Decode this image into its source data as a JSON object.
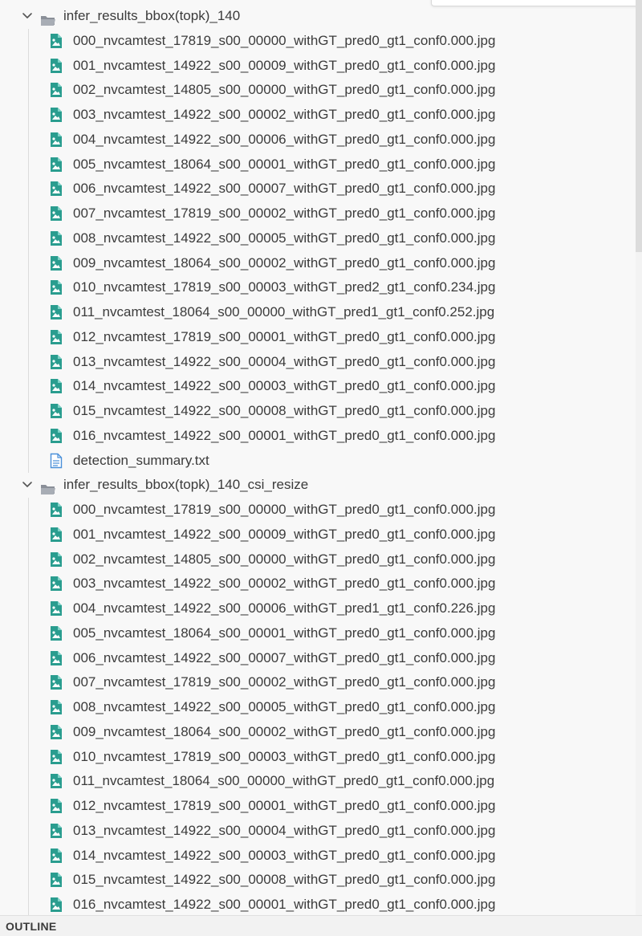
{
  "explorer": {
    "folders": [
      {
        "name": "infer_results_bbox(topk)_140",
        "expanded": true,
        "files": [
          {
            "name": "000_nvcamtest_17819_s00_00000_withGT_pred0_gt1_conf0.000.jpg",
            "icon": "image-file-icon"
          },
          {
            "name": "001_nvcamtest_14922_s00_00009_withGT_pred0_gt1_conf0.000.jpg",
            "icon": "image-file-icon"
          },
          {
            "name": "002_nvcamtest_14805_s00_00000_withGT_pred0_gt1_conf0.000.jpg",
            "icon": "image-file-icon"
          },
          {
            "name": "003_nvcamtest_14922_s00_00002_withGT_pred0_gt1_conf0.000.jpg",
            "icon": "image-file-icon"
          },
          {
            "name": "004_nvcamtest_14922_s00_00006_withGT_pred0_gt1_conf0.000.jpg",
            "icon": "image-file-icon"
          },
          {
            "name": "005_nvcamtest_18064_s00_00001_withGT_pred0_gt1_conf0.000.jpg",
            "icon": "image-file-icon"
          },
          {
            "name": "006_nvcamtest_14922_s00_00007_withGT_pred0_gt1_conf0.000.jpg",
            "icon": "image-file-icon"
          },
          {
            "name": "007_nvcamtest_17819_s00_00002_withGT_pred0_gt1_conf0.000.jpg",
            "icon": "image-file-icon"
          },
          {
            "name": "008_nvcamtest_14922_s00_00005_withGT_pred0_gt1_conf0.000.jpg",
            "icon": "image-file-icon"
          },
          {
            "name": "009_nvcamtest_18064_s00_00002_withGT_pred0_gt1_conf0.000.jpg",
            "icon": "image-file-icon"
          },
          {
            "name": "010_nvcamtest_17819_s00_00003_withGT_pred2_gt1_conf0.234.jpg",
            "icon": "image-file-icon"
          },
          {
            "name": "011_nvcamtest_18064_s00_00000_withGT_pred1_gt1_conf0.252.jpg",
            "icon": "image-file-icon"
          },
          {
            "name": "012_nvcamtest_17819_s00_00001_withGT_pred0_gt1_conf0.000.jpg",
            "icon": "image-file-icon"
          },
          {
            "name": "013_nvcamtest_14922_s00_00004_withGT_pred0_gt1_conf0.000.jpg",
            "icon": "image-file-icon"
          },
          {
            "name": "014_nvcamtest_14922_s00_00003_withGT_pred0_gt1_conf0.000.jpg",
            "icon": "image-file-icon"
          },
          {
            "name": "015_nvcamtest_14922_s00_00008_withGT_pred0_gt1_conf0.000.jpg",
            "icon": "image-file-icon"
          },
          {
            "name": "016_nvcamtest_14922_s00_00001_withGT_pred0_gt1_conf0.000.jpg",
            "icon": "image-file-icon"
          },
          {
            "name": "detection_summary.txt",
            "icon": "text-file-icon"
          }
        ]
      },
      {
        "name": "infer_results_bbox(topk)_140_csi_resize",
        "expanded": true,
        "files": [
          {
            "name": "000_nvcamtest_17819_s00_00000_withGT_pred0_gt1_conf0.000.jpg",
            "icon": "image-file-icon"
          },
          {
            "name": "001_nvcamtest_14922_s00_00009_withGT_pred0_gt1_conf0.000.jpg",
            "icon": "image-file-icon"
          },
          {
            "name": "002_nvcamtest_14805_s00_00000_withGT_pred0_gt1_conf0.000.jpg",
            "icon": "image-file-icon"
          },
          {
            "name": "003_nvcamtest_14922_s00_00002_withGT_pred0_gt1_conf0.000.jpg",
            "icon": "image-file-icon"
          },
          {
            "name": "004_nvcamtest_14922_s00_00006_withGT_pred1_gt1_conf0.226.jpg",
            "icon": "image-file-icon"
          },
          {
            "name": "005_nvcamtest_18064_s00_00001_withGT_pred0_gt1_conf0.000.jpg",
            "icon": "image-file-icon"
          },
          {
            "name": "006_nvcamtest_14922_s00_00007_withGT_pred0_gt1_conf0.000.jpg",
            "icon": "image-file-icon"
          },
          {
            "name": "007_nvcamtest_17819_s00_00002_withGT_pred0_gt1_conf0.000.jpg",
            "icon": "image-file-icon"
          },
          {
            "name": "008_nvcamtest_14922_s00_00005_withGT_pred0_gt1_conf0.000.jpg",
            "icon": "image-file-icon"
          },
          {
            "name": "009_nvcamtest_18064_s00_00002_withGT_pred0_gt1_conf0.000.jpg",
            "icon": "image-file-icon"
          },
          {
            "name": "010_nvcamtest_17819_s00_00003_withGT_pred0_gt1_conf0.000.jpg",
            "icon": "image-file-icon"
          },
          {
            "name": "011_nvcamtest_18064_s00_00000_withGT_pred0_gt1_conf0.000.jpg",
            "icon": "image-file-icon"
          },
          {
            "name": "012_nvcamtest_17819_s00_00001_withGT_pred0_gt1_conf0.000.jpg",
            "icon": "image-file-icon"
          },
          {
            "name": "013_nvcamtest_14922_s00_00004_withGT_pred0_gt1_conf0.000.jpg",
            "icon": "image-file-icon"
          },
          {
            "name": "014_nvcamtest_14922_s00_00003_withGT_pred0_gt1_conf0.000.jpg",
            "icon": "image-file-icon"
          },
          {
            "name": "015_nvcamtest_14922_s00_00008_withGT_pred0_gt1_conf0.000.jpg",
            "icon": "image-file-icon"
          },
          {
            "name": "016_nvcamtest_14922_s00_00001_withGT_pred0_gt1_conf0.000.jpg",
            "icon": "image-file-icon"
          }
        ]
      }
    ]
  },
  "outline": {
    "title": "OUTLINE"
  },
  "colors": {
    "image_icon": "#2a9d8f",
    "text_icon": "#4a90d9",
    "folder_icon": "#8a8f98",
    "text": "#3b3b3b",
    "background": "#f8f8f8"
  }
}
